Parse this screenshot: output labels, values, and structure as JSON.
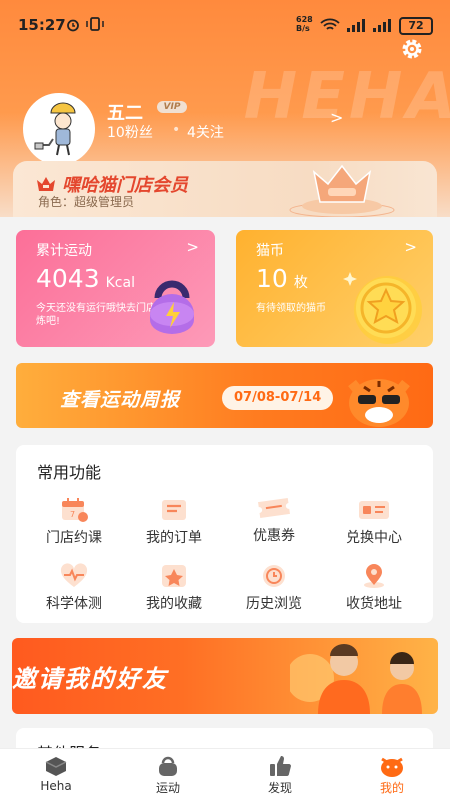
{
  "status_bar": {
    "time": "15:27",
    "net_speed_value": "628",
    "net_speed_unit": "B/s",
    "battery": "72"
  },
  "header": {
    "watermark": "HEHA"
  },
  "profile": {
    "name": "五二",
    "badge": "VIP",
    "fans": "10粉丝",
    "follows": "4关注",
    "arrow": ">"
  },
  "member": {
    "title": "嘿哈猫门店会员",
    "role": "角色：超级管理员"
  },
  "stats": [
    {
      "title": "累计运动",
      "value": "4043",
      "unit": "Kcal",
      "note": "今天还没有运行哦快去门店锻炼吧!",
      "arrow": ">"
    },
    {
      "title": "猫币",
      "value": "10",
      "unit": "枚",
      "note": "有待领取的猫币",
      "arrow": ">"
    }
  ],
  "weekly": {
    "title": "查看运动周报",
    "date": "07/08-07/14"
  },
  "functions": {
    "title": "常用功能",
    "items": [
      {
        "label": "门店约课",
        "icon": "calendar-icon"
      },
      {
        "label": "我的订单",
        "icon": "order-icon"
      },
      {
        "label": "优惠券",
        "icon": "coupon-icon"
      },
      {
        "label": "兑换中心",
        "icon": "exchange-icon"
      },
      {
        "label": "科学体测",
        "icon": "heartbeat-icon"
      },
      {
        "label": "我的收藏",
        "icon": "star-icon"
      },
      {
        "label": "历史浏览",
        "icon": "history-icon"
      },
      {
        "label": "收货地址",
        "icon": "location-icon"
      }
    ]
  },
  "invite": {
    "title": "邀请我的好友"
  },
  "other": {
    "title": "其他服务"
  },
  "tabs": [
    {
      "label": "Heha",
      "icon": "heha-icon",
      "active": false
    },
    {
      "label": "运动",
      "icon": "kettlebell-icon",
      "active": false
    },
    {
      "label": "发现",
      "icon": "thumbs-up-icon",
      "active": false
    },
    {
      "label": "我的",
      "icon": "profile-face-icon",
      "active": true
    }
  ],
  "colors": {
    "accent": "#ff6a14",
    "pink": "#fc6f98",
    "gold": "#ffb12f",
    "member_red": "#e4472e"
  }
}
